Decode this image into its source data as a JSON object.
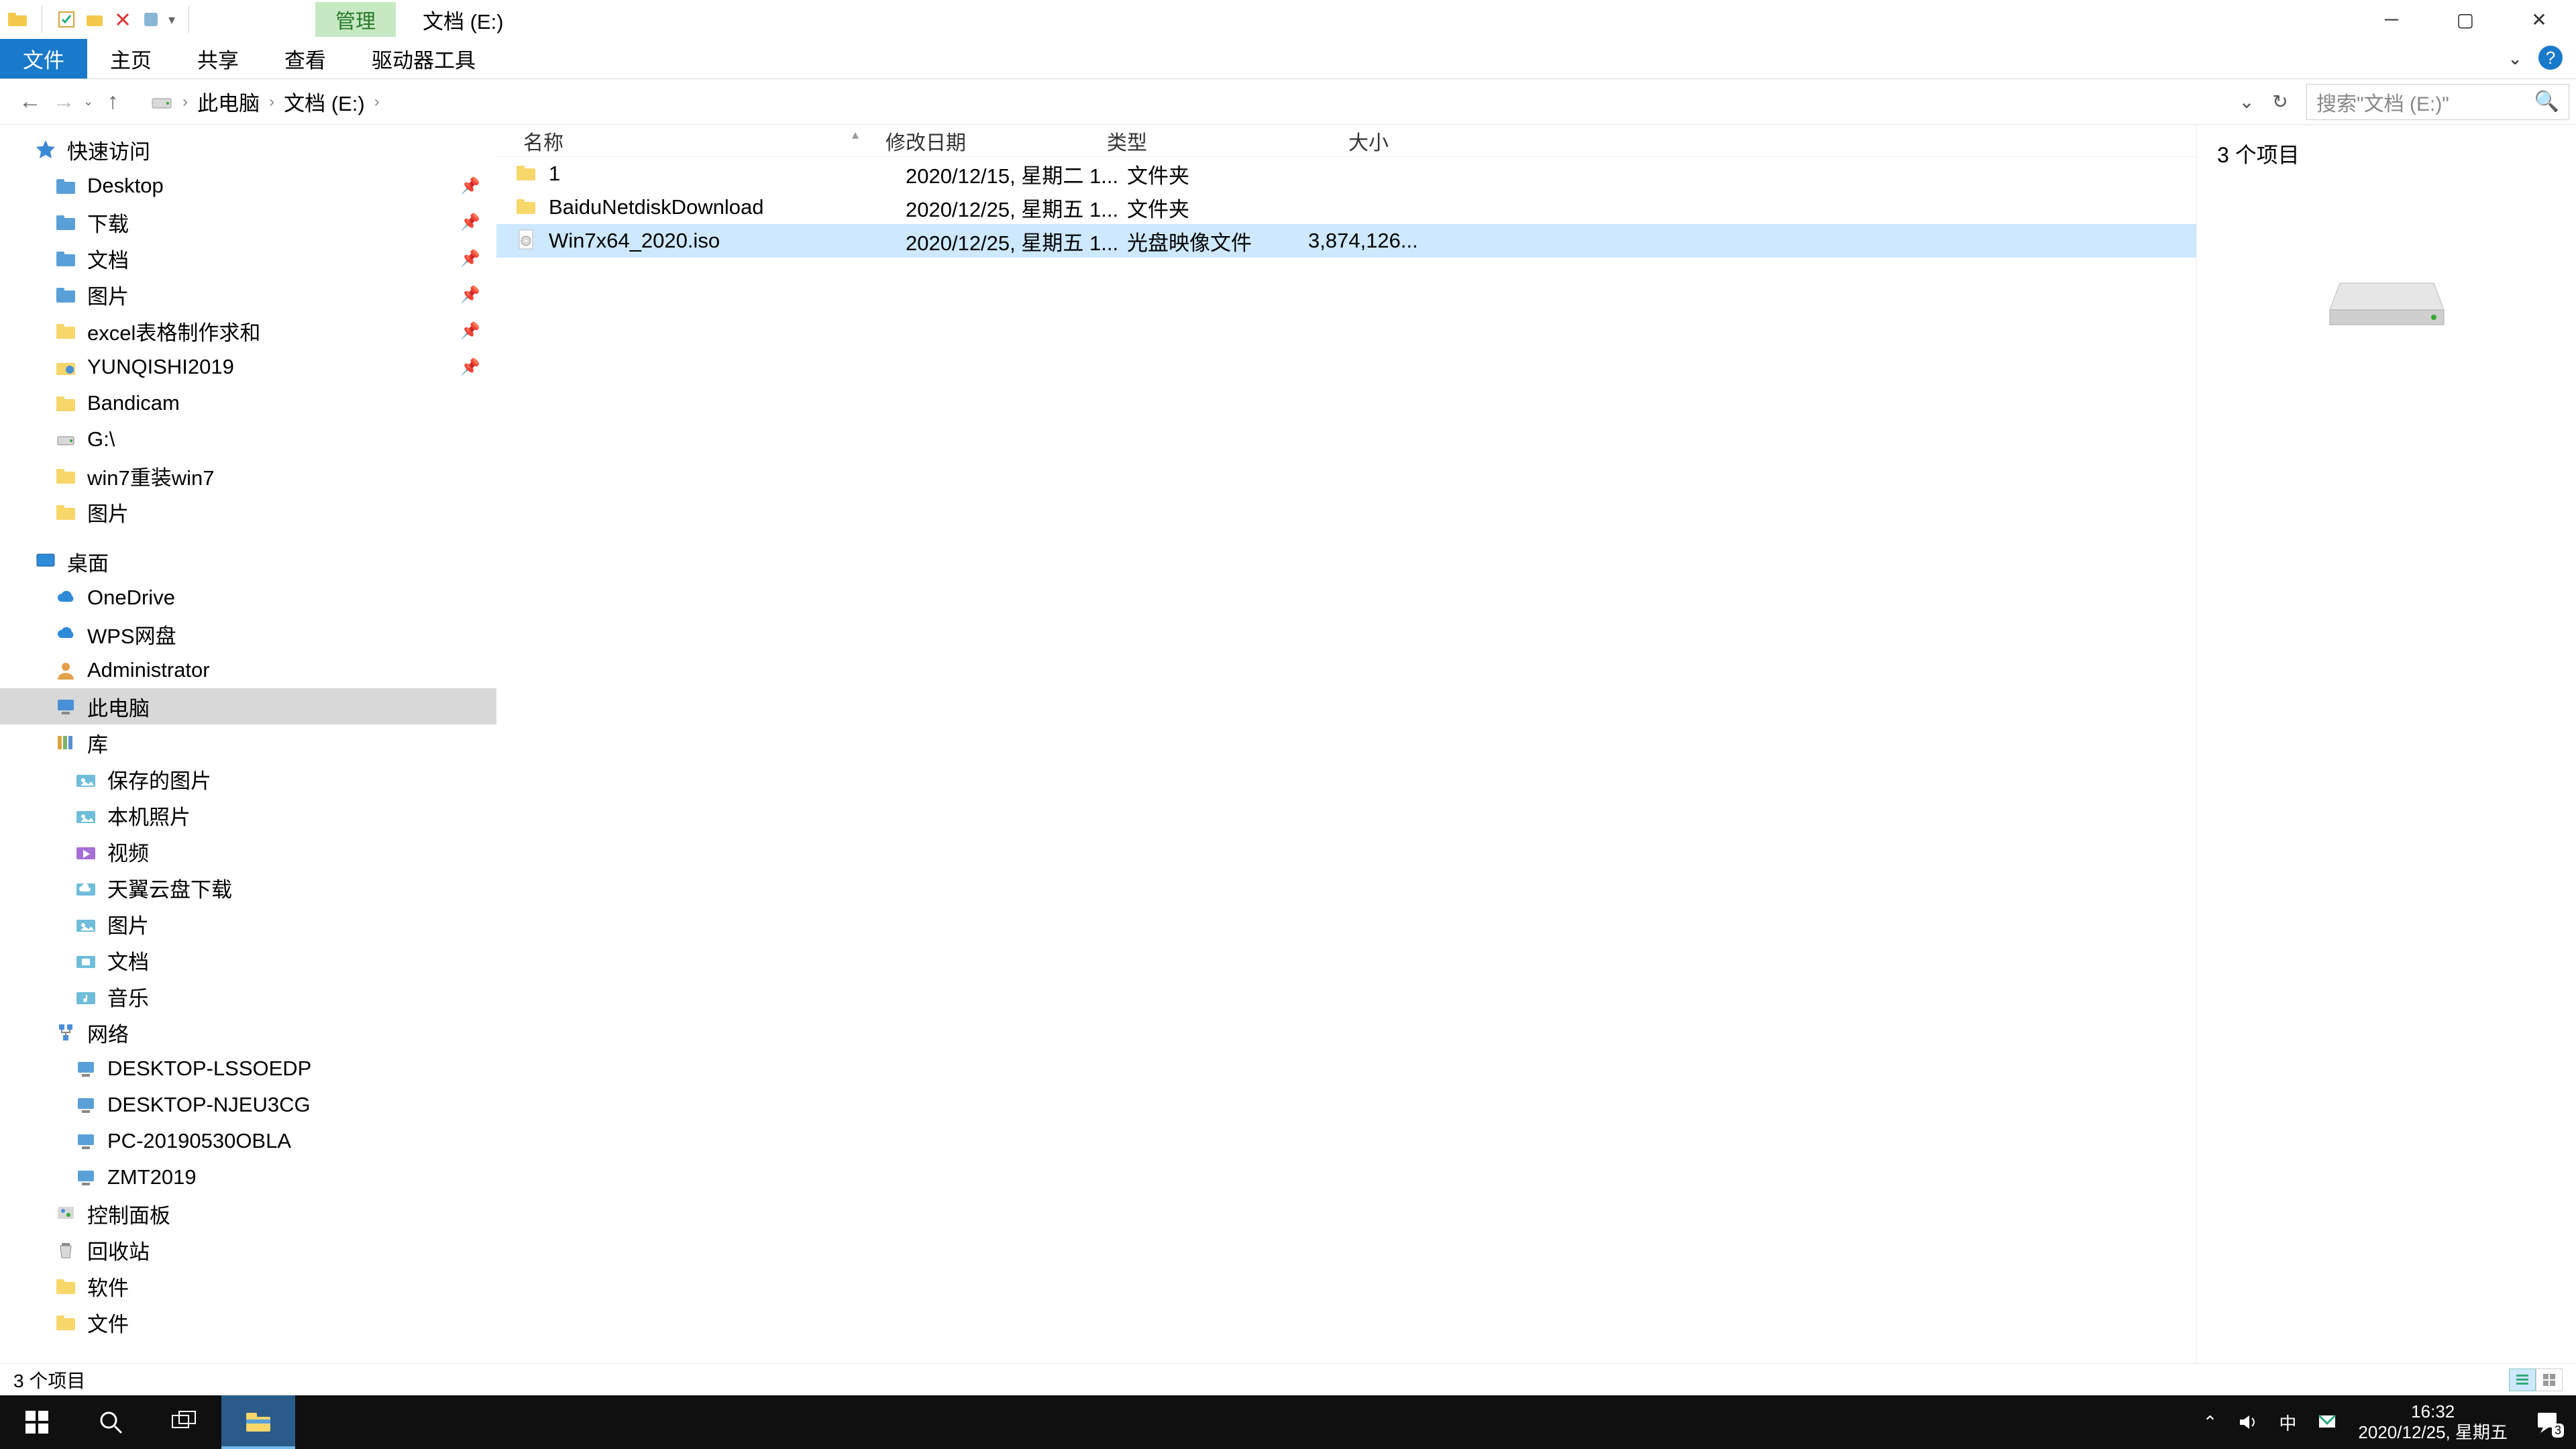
{
  "title": {
    "manage_tab": "管理",
    "window_title": "文档 (E:)"
  },
  "ribbon": {
    "file": "文件",
    "home": "主页",
    "share": "共享",
    "view": "查看",
    "drive_tools": "驱动器工具"
  },
  "breadcrumb": {
    "this_pc": "此电脑",
    "drive": "文档 (E:)"
  },
  "search": {
    "placeholder": "搜索\"文档 (E:)\""
  },
  "tree": {
    "quick_access": "快速访问",
    "items_qa": [
      {
        "label": "Desktop",
        "icon": "folder-blue",
        "pin": true
      },
      {
        "label": "下载",
        "icon": "folder-blue",
        "pin": true
      },
      {
        "label": "文档",
        "icon": "folder-blue",
        "pin": true
      },
      {
        "label": "图片",
        "icon": "folder-blue",
        "pin": true
      },
      {
        "label": "excel表格制作求和",
        "icon": "folder",
        "pin": true
      },
      {
        "label": "YUNQISHI2019",
        "icon": "folder-app",
        "pin": true
      },
      {
        "label": "Bandicam",
        "icon": "folder",
        "pin": false
      },
      {
        "label": "G:\\",
        "icon": "drive-usb",
        "pin": false
      },
      {
        "label": "win7重装win7",
        "icon": "folder",
        "pin": false
      },
      {
        "label": "图片",
        "icon": "folder",
        "pin": false
      }
    ],
    "desktop": "桌面",
    "items_desktop": [
      {
        "label": "OneDrive",
        "icon": "cloud-blue"
      },
      {
        "label": "WPS网盘",
        "icon": "cloud-blue"
      },
      {
        "label": "Administrator",
        "icon": "user"
      },
      {
        "label": "此电脑",
        "icon": "pc",
        "sel": true
      },
      {
        "label": "库",
        "icon": "library"
      },
      {
        "label": "保存的图片",
        "icon": "folder-pic",
        "l": 2
      },
      {
        "label": "本机照片",
        "icon": "folder-pic",
        "l": 2
      },
      {
        "label": "视频",
        "icon": "folder-vid",
        "l": 2
      },
      {
        "label": "天翼云盘下载",
        "icon": "folder-cloud",
        "l": 2
      },
      {
        "label": "图片",
        "icon": "folder-pic",
        "l": 2
      },
      {
        "label": "文档",
        "icon": "folder-doc",
        "l": 2
      },
      {
        "label": "音乐",
        "icon": "folder-music",
        "l": 2
      },
      {
        "label": "网络",
        "icon": "network"
      },
      {
        "label": "DESKTOP-LSSOEDP",
        "icon": "pc-net",
        "l": 2
      },
      {
        "label": "DESKTOP-NJEU3CG",
        "icon": "pc-net",
        "l": 2
      },
      {
        "label": "PC-20190530OBLA",
        "icon": "pc-net",
        "l": 2
      },
      {
        "label": "ZMT2019",
        "icon": "pc-net",
        "l": 2
      },
      {
        "label": "控制面板",
        "icon": "control"
      },
      {
        "label": "回收站",
        "icon": "recycle"
      },
      {
        "label": "软件",
        "icon": "folder"
      },
      {
        "label": "文件",
        "icon": "folder"
      }
    ]
  },
  "columns": {
    "name": "名称",
    "date": "修改日期",
    "type": "类型",
    "size": "大小"
  },
  "files": [
    {
      "name": "1",
      "date": "2020/12/15, 星期二 1...",
      "type": "文件夹",
      "size": "",
      "icon": "folder"
    },
    {
      "name": "BaiduNetdiskDownload",
      "date": "2020/12/25, 星期五 1...",
      "type": "文件夹",
      "size": "",
      "icon": "folder"
    },
    {
      "name": "Win7x64_2020.iso",
      "date": "2020/12/25, 星期五 1...",
      "type": "光盘映像文件",
      "size": "3,874,126...",
      "icon": "disc",
      "sel": true
    }
  ],
  "preview": {
    "count_text": "3 个项目"
  },
  "statusbar": {
    "count_text": "3 个项目"
  },
  "tray": {
    "ime": "中",
    "time": "16:32",
    "date": "2020/12/25, 星期五",
    "notif_count": "3"
  }
}
